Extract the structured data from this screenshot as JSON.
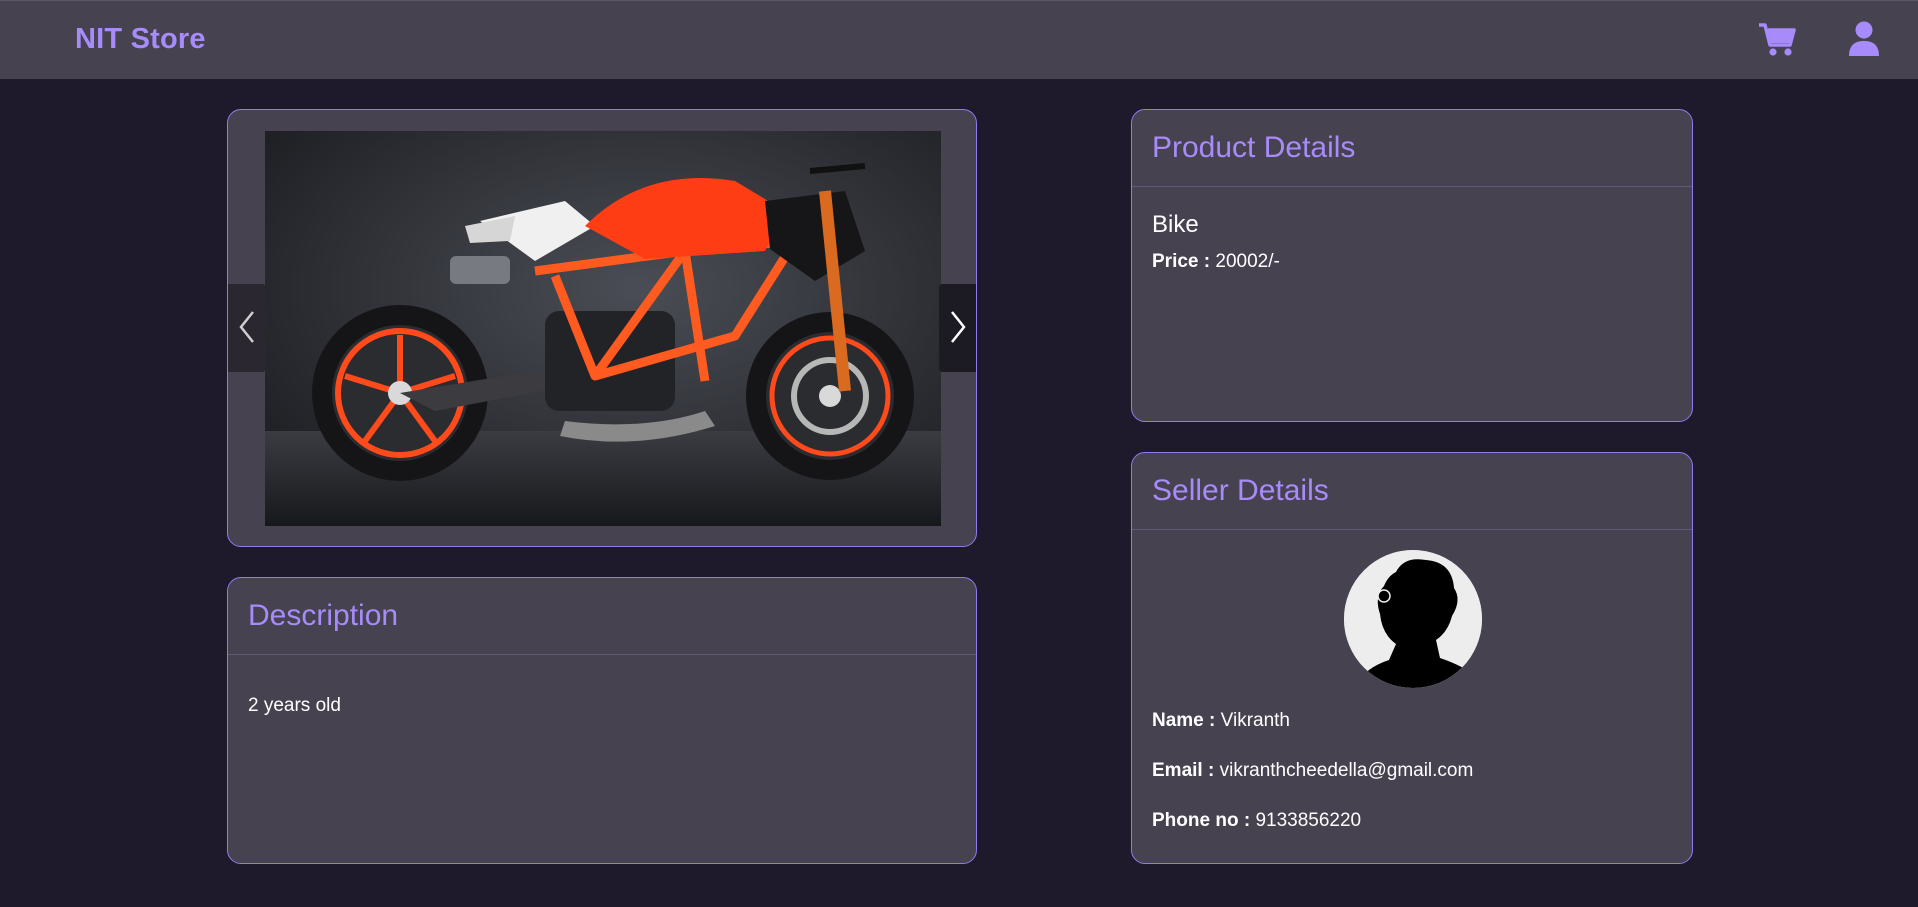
{
  "navbar": {
    "brand": "NIT Store",
    "icons": [
      "shopping-cart-icon",
      "user-icon"
    ],
    "accent_color": "#a78bfa"
  },
  "carousel": {
    "image_subject": "orange KTM naked sport motorcycle",
    "prev_icon": "chevron-left-icon",
    "next_icon": "chevron-right-icon"
  },
  "description": {
    "title": "Description",
    "text": "2 years old"
  },
  "product": {
    "title": "Product Details",
    "name": "Bike",
    "price_label": "Price :",
    "price_value": "20002/-"
  },
  "seller": {
    "title": "Seller Details",
    "name_label": "Name :",
    "name_value": "Vikranth",
    "email_label": "Email :",
    "email_value": "vikranthcheedella@gmail.com",
    "phone_label": "Phone no :",
    "phone_value": "9133856220"
  }
}
